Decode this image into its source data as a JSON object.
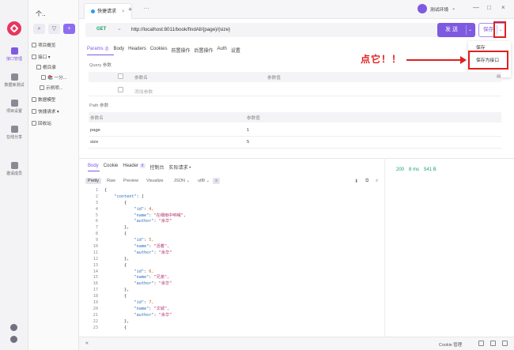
{
  "rail": {
    "items": [
      {
        "label": "接口管理",
        "active": true
      },
      {
        "label": "数据库测试",
        "active": false
      },
      {
        "label": "项目设置",
        "active": false
      },
      {
        "label": "在线分享",
        "active": false
      },
      {
        "label": "邀请成员",
        "active": false
      }
    ]
  },
  "tree": {
    "project_name": "个..",
    "items": [
      {
        "label": "项目概览"
      },
      {
        "label": "接口 ▾"
      },
      {
        "label": "根目录"
      },
      {
        "label": "📚 一分..."
      },
      {
        "label": "示例项..."
      },
      {
        "label": "数据模型"
      },
      {
        "label": "快捷请求 ▾"
      },
      {
        "label": "回收站"
      }
    ]
  },
  "tabbar": {
    "tab_label": "快捷请求",
    "plus": "+",
    "more": "···",
    "environment": "测试环境",
    "win_min": "—",
    "win_max": "□",
    "win_close": "×"
  },
  "request": {
    "method": "GET",
    "url": "http://localhost:8011/book/findAll/{page}/{size}",
    "send_label": "发 送",
    "save_label": "保存",
    "save_menu": [
      "保存",
      "保存为接口"
    ],
    "tabs": [
      {
        "label": "Params",
        "badge": "2",
        "active": true
      },
      {
        "label": "Body"
      },
      {
        "label": "Headers"
      },
      {
        "label": "Cookies"
      },
      {
        "label": "前置操作"
      },
      {
        "label": "后置操作"
      },
      {
        "label": "Auth"
      },
      {
        "label": "设置"
      }
    ],
    "query_title": "Query 参数",
    "query_headers": [
      "参数名",
      "参数值"
    ],
    "query_placeholder": "添加参数",
    "path_title": "Path 参数",
    "path_headers": [
      "参数名",
      "参数值"
    ],
    "path_params": [
      {
        "name": "page",
        "value": "1"
      },
      {
        "name": "size",
        "value": "5"
      }
    ]
  },
  "annotation": {
    "text": "点它！！"
  },
  "response": {
    "tabs": [
      {
        "label": "Body",
        "active": true
      },
      {
        "label": "Cookie"
      },
      {
        "label": "Header",
        "badge": "8"
      },
      {
        "label": "控制台"
      },
      {
        "label": "实际请求 •"
      }
    ],
    "status": {
      "code": "200",
      "time": "8 ms",
      "size": "541 B"
    },
    "views": [
      "Pretty",
      "Raw",
      "Preview",
      "Visualize"
    ],
    "format": "JSON",
    "encoding": "utf8",
    "code_lines": [
      "{",
      "    \"content\": [",
      "        {",
      "            \"id\": 4,",
      "            \"name\": \"在细雨中呐喊\",",
      "            \"author\": \"余华\"",
      "        },",
      "        {",
      "            \"id\": 5,",
      "            \"name\": \"活着\",",
      "            \"author\": \"余华\"",
      "        },",
      "        {",
      "            \"id\": 6,",
      "            \"name\": \"兄弟\",",
      "            \"author\": \"余华\"",
      "        },",
      "        {",
      "            \"id\": 7,",
      "            \"name\": \"文城\",",
      "            \"author\": \"余华\"",
      "        },",
      "        {"
    ]
  },
  "statusbar": {
    "collapse": "«",
    "cookie_label": "Cookie 管理"
  }
}
